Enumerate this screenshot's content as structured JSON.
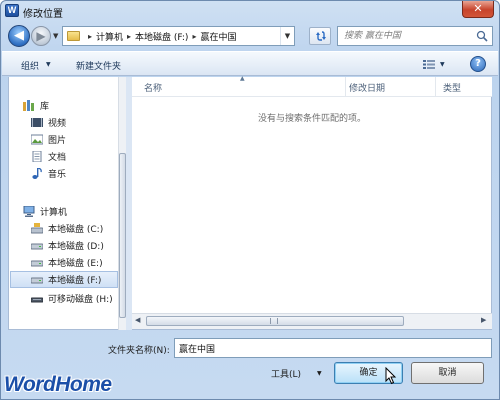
{
  "window": {
    "title": "修改位置",
    "app_icon_letter": "W",
    "close_glyph": "✕"
  },
  "nav": {
    "back_glyph": "◀",
    "forward_glyph": "▶"
  },
  "address_bar": {
    "crumbs": [
      "计算机",
      "本地磁盘 (F:)",
      "赢在中国"
    ],
    "separator": "▸"
  },
  "search": {
    "placeholder": "搜索 赢在中国"
  },
  "toolbar": {
    "organize_label": "组织",
    "new_folder_label": "新建文件夹",
    "help_glyph": "?"
  },
  "sidebar": {
    "items": [
      {
        "label": "库",
        "icon": "library-icon"
      },
      {
        "label": "视频",
        "icon": "video-icon"
      },
      {
        "label": "图片",
        "icon": "picture-icon"
      },
      {
        "label": "文档",
        "icon": "document-icon"
      },
      {
        "label": "音乐",
        "icon": "music-icon"
      },
      {
        "label": "计算机",
        "icon": "computer-icon"
      },
      {
        "label": "本地磁盘 (C:)",
        "icon": "drive-icon"
      },
      {
        "label": "本地磁盘 (D:)",
        "icon": "drive-icon"
      },
      {
        "label": "本地磁盘 (E:)",
        "icon": "drive-icon"
      },
      {
        "label": "本地磁盘 (F:)",
        "icon": "drive-icon",
        "selected": true
      },
      {
        "label": "可移动磁盘 (H:)",
        "icon": "removable-drive-icon"
      }
    ]
  },
  "file_list": {
    "columns": [
      "名称",
      "修改日期",
      "类型"
    ],
    "empty_message": "没有与搜索条件匹配的项。"
  },
  "footer": {
    "folder_name_label": "文件夹名称(N):",
    "folder_name_value": "赢在中国",
    "tools_label": "工具(L)",
    "ok_label": "确定",
    "cancel_label": "取消"
  },
  "watermark": {
    "text": "WordHome"
  },
  "colors": {
    "accent": "#1b4fa8",
    "close": "#c7442c",
    "frame": "#bcd3ee"
  }
}
